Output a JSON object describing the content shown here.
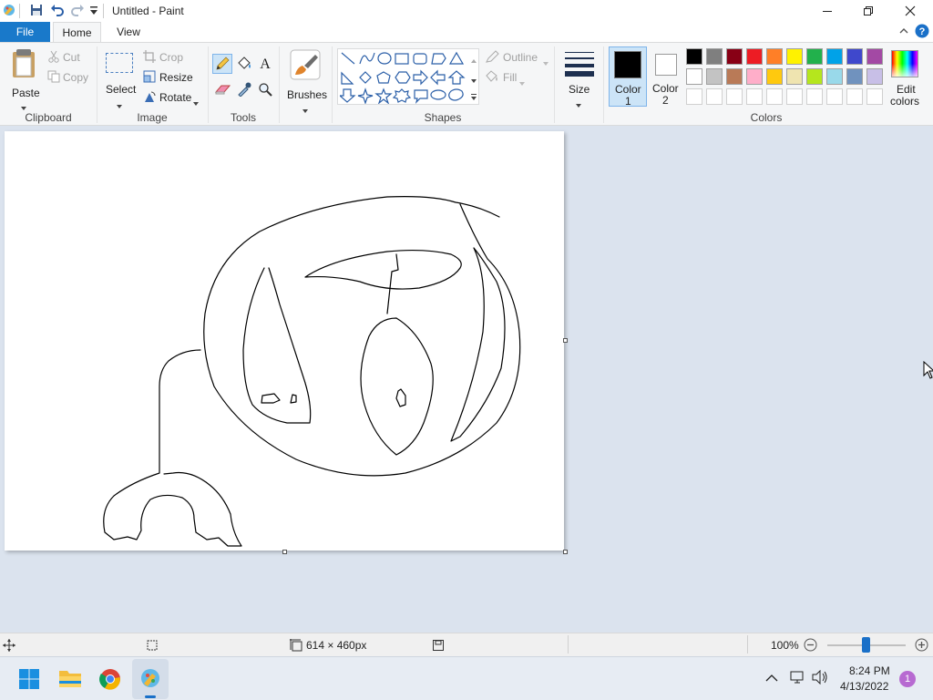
{
  "window": {
    "title": "Untitled - Paint"
  },
  "tabs": {
    "file": "File",
    "home": "Home",
    "view": "View"
  },
  "clipboard": {
    "paste": "Paste",
    "cut": "Cut",
    "copy": "Copy",
    "group": "Clipboard"
  },
  "image": {
    "select": "Select",
    "crop": "Crop",
    "resize": "Resize",
    "rotate": "Rotate",
    "group": "Image"
  },
  "tools": {
    "group": "Tools"
  },
  "brushes": {
    "label": "Brushes"
  },
  "shapes": {
    "outline": "Outline",
    "fill": "Fill",
    "group": "Shapes"
  },
  "size": {
    "label": "Size"
  },
  "colors": {
    "color1_a": "Color",
    "color1_b": "1",
    "color2_a": "Color",
    "color2_b": "2",
    "edit_a": "Edit",
    "edit_b": "colors",
    "group": "Colors",
    "color1": "#000000",
    "color2": "#ffffff",
    "palette_row1": [
      "#000000",
      "#7f7f7f",
      "#880015",
      "#ed1c24",
      "#ff7f27",
      "#fff200",
      "#22b14c",
      "#00a2e8",
      "#3f48cc",
      "#a349a4"
    ],
    "palette_row2": [
      "#ffffff",
      "#c3c3c3",
      "#b97a57",
      "#ffaec9",
      "#ffc90e",
      "#efe4b0",
      "#b5e61d",
      "#99d9ea",
      "#7092be",
      "#c8bfe7"
    ],
    "palette_row3": [
      "#ffffff",
      "#ffffff",
      "#ffffff",
      "#ffffff",
      "#ffffff",
      "#ffffff",
      "#ffffff",
      "#ffffff",
      "#ffffff",
      "#ffffff"
    ]
  },
  "status": {
    "dimensions": "614 × 460px",
    "zoom": "100%"
  },
  "taskbar": {
    "time": "8:24 PM",
    "date": "4/13/2022",
    "notifications": "1"
  }
}
